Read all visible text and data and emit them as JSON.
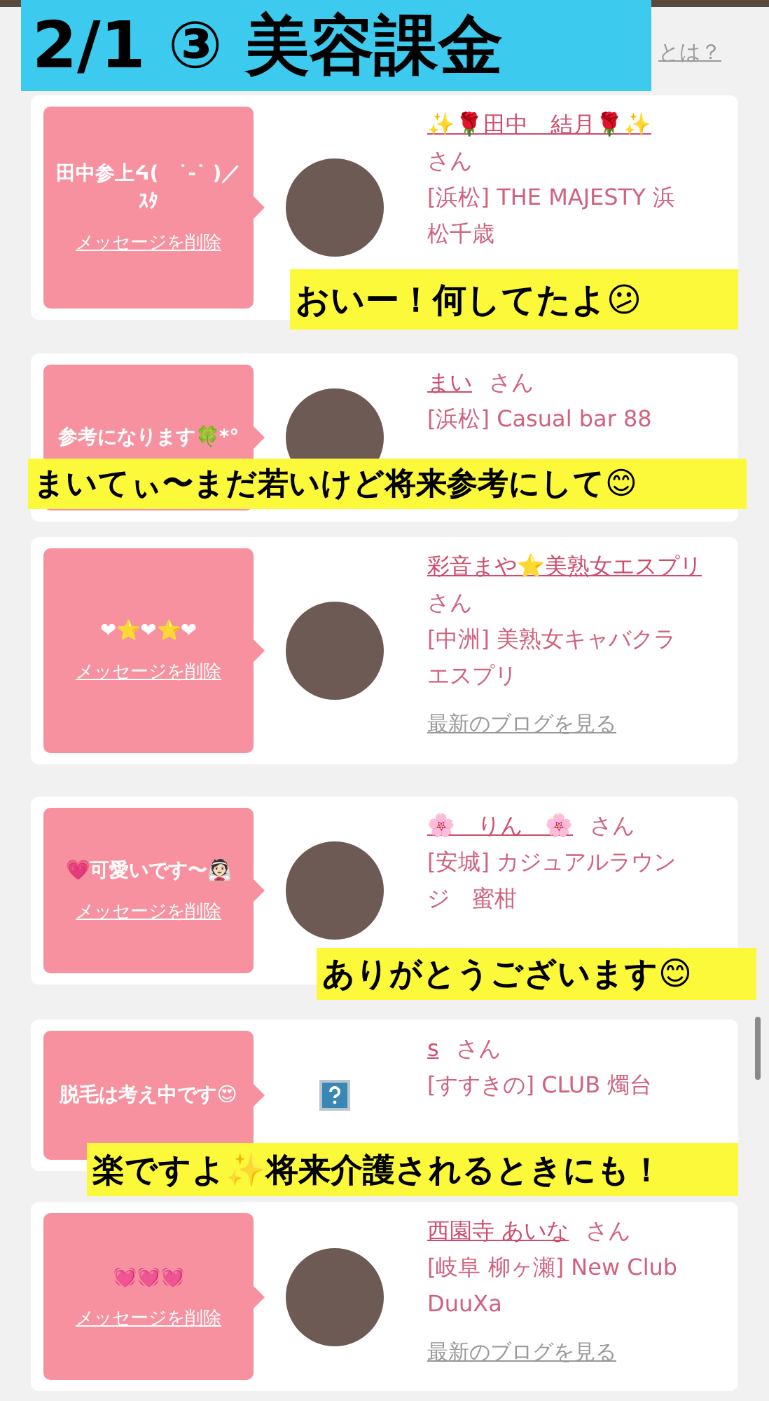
{
  "header": {
    "caption": "2/1 ③ 美容課金",
    "link": "とは？"
  },
  "cards": [
    {
      "message": "田中参上ᔦ(　˙-˙ )／ｽﾀ",
      "delete_link": "メッセージを削除",
      "avatar": {
        "kind": "photo"
      },
      "name": "✨🌹田中　結月🌹✨",
      "honorific": "さん",
      "shop": "[浜松] THE MAJESTY 浜松千歳",
      "caption": "おいー！何してたよ😕"
    },
    {
      "message": "参考になります🍀*°",
      "avatar": {
        "kind": "photo"
      },
      "name": "まい",
      "honorific": "さん",
      "shop": "[浜松] Casual bar 88",
      "caption": "まいてぃ〜まだ若いけど将来参考にして😊"
    },
    {
      "message": "❤︎⭐❤︎⭐❤︎",
      "delete_link": "メッセージを削除",
      "avatar": {
        "kind": "photo"
      },
      "name": "彩音まや⭐美熟女エスプリ",
      "honorific": "さん",
      "shop": "[中洲] 美熟女キャバクラエスプリ",
      "blog_link": "最新のブログを見る"
    },
    {
      "message": "💗可愛いです〜👰🏻",
      "delete_link": "メッセージを削除",
      "avatar": {
        "kind": "photo"
      },
      "name": "🌸　りん　🌸",
      "honorific": "さん",
      "shop": "[安城] カジュアルラウンジ　蜜柑",
      "caption": "ありがとうございます😊"
    },
    {
      "message": "脱毛は考え中です😍",
      "avatar": {
        "kind": "broken"
      },
      "name": "s",
      "honorific": "さん",
      "shop": "[すすきの] CLUB 燭台",
      "caption": "楽ですよ✨将来介護されるときにも！"
    },
    {
      "message": "💓💓💓",
      "delete_link": "メッセージを削除",
      "avatar": {
        "kind": "photo"
      },
      "name": "西園寺 あいな",
      "honorific": "さん",
      "shop": "[岐阜 柳ヶ瀬] New Club DuuXa",
      "blog_link": "最新のブログを見る"
    }
  ]
}
